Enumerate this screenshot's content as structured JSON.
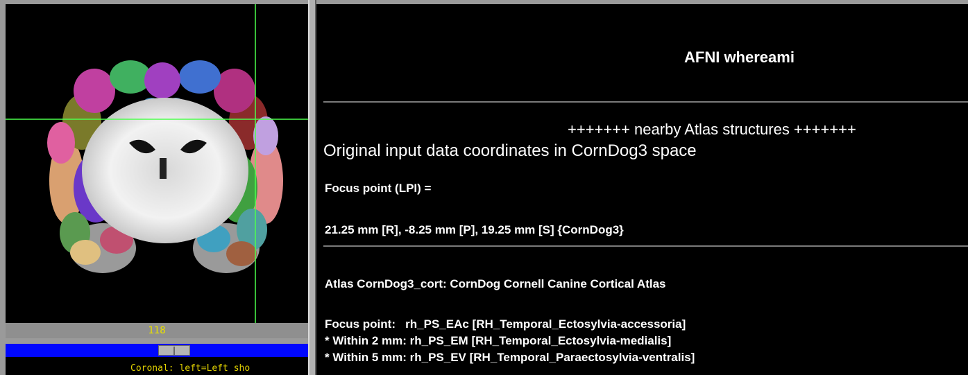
{
  "viewer": {
    "slice_number": "118",
    "status_text": "Coronal: left=Left sho",
    "crosshair_color": "#4cff4c",
    "background": "#000000"
  },
  "whereami": {
    "title": "AFNI whereami",
    "nearby_heading": "+++++++ nearby Atlas structures +++++++",
    "original_coords": "Original input data coordinates in CornDog3 space",
    "focus_label": "Focus point (LPI) =",
    "focus_coords": "21.25 mm [R], -8.25 mm [P], 19.25 mm [S] {CornDog3}",
    "atlas_name": "Atlas CornDog3_cort: CornDog Cornell Canine Cortical Atlas",
    "results": [
      "Focus point:   rh_PS_EAc [RH_Temporal_Ectosylvia-accessoria]",
      "* Within 2 mm: rh_PS_EM [RH_Temporal_Ectosylvia-medialis]",
      "* Within 5 mm: rh_PS_EV [RH_Temporal_Paraectosylvia-ventralis]"
    ]
  },
  "colors": {
    "slider_track": "#0007ff",
    "slice_number_text": "#e8e000",
    "panel_background": "#000000",
    "panel_text": "#ffffff"
  }
}
